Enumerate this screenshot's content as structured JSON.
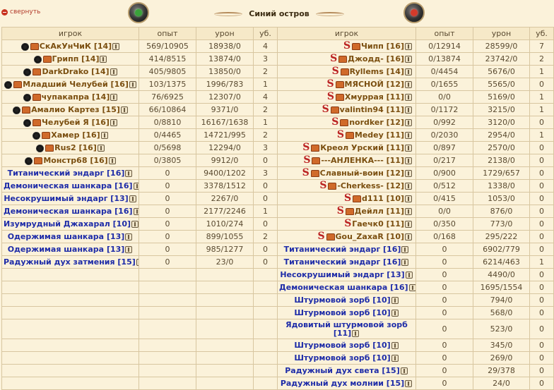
{
  "collapse_label": "свернуть",
  "battle_title": "Синий остров",
  "columns": {
    "player": "игрок",
    "exp": "опыт",
    "dmg": "урон",
    "kills": "уб."
  },
  "left": [
    {
      "name": "СкАкУнЧиК [14]",
      "type": "player",
      "ally": true,
      "crown": true,
      "exp": "569/10905",
      "dmg": "18938/0",
      "kills": "4"
    },
    {
      "name": "Грипп [14]",
      "type": "player",
      "ally": true,
      "crown": true,
      "exp": "414/8515",
      "dmg": "13874/0",
      "kills": "3"
    },
    {
      "name": "DarkDrako [14]",
      "type": "player",
      "ally": true,
      "crown": true,
      "exp": "405/9805",
      "dmg": "13850/0",
      "kills": "2"
    },
    {
      "name": "Младший Челубей [16]",
      "type": "player",
      "ally": true,
      "crown": true,
      "exp": "103/1375",
      "dmg": "1996/783",
      "kills": "1"
    },
    {
      "name": "чупакапра [14]",
      "type": "player",
      "ally": true,
      "crown": true,
      "exp": "76/6925",
      "dmg": "12307/0",
      "kills": "4"
    },
    {
      "name": "Амалио Картез [15]",
      "type": "player",
      "ally": true,
      "crown": true,
      "exp": "66/10864",
      "dmg": "9371/0",
      "kills": "2"
    },
    {
      "name": "Челубей Я [16]",
      "type": "player",
      "ally": true,
      "crown": true,
      "exp": "0/8810",
      "dmg": "16167/1638",
      "kills": "1"
    },
    {
      "name": "Хамер [16]",
      "type": "player",
      "ally": true,
      "crown": true,
      "exp": "0/4465",
      "dmg": "14721/995",
      "kills": "2"
    },
    {
      "name": "Rus2 [16]",
      "type": "player",
      "ally": true,
      "crown": true,
      "exp": "0/5698",
      "dmg": "12294/0",
      "kills": "3"
    },
    {
      "name": "Монстр68 [16]",
      "type": "player",
      "ally": true,
      "crown": true,
      "exp": "0/3805",
      "dmg": "9912/0",
      "kills": "0"
    },
    {
      "name": "Титанический эндарг [16]",
      "type": "bot",
      "exp": "0",
      "dmg": "9400/1202",
      "kills": "3"
    },
    {
      "name": "Демоническая шанкара [16]",
      "type": "bot",
      "exp": "0",
      "dmg": "3378/1512",
      "kills": "0"
    },
    {
      "name": "Несокрушимый эндарг [13]",
      "type": "bot",
      "exp": "0",
      "dmg": "2267/0",
      "kills": "0"
    },
    {
      "name": "Демоническая шанкара [16]",
      "type": "bot",
      "exp": "0",
      "dmg": "2177/2246",
      "kills": "1"
    },
    {
      "name": "Изумрудный Джахарал [10]",
      "type": "bot",
      "exp": "0",
      "dmg": "1010/274",
      "kills": "0"
    },
    {
      "name": "Одержимая шанкара [13]",
      "type": "bot",
      "exp": "0",
      "dmg": "899/1055",
      "kills": "2"
    },
    {
      "name": "Одержимая шанкара [13]",
      "type": "bot",
      "exp": "0",
      "dmg": "985/1277",
      "kills": "0"
    },
    {
      "name": "Радужный дух затмения [15]",
      "type": "bot",
      "exp": "0",
      "dmg": "23/0",
      "kills": "0"
    }
  ],
  "right": [
    {
      "name": "Чипп [16]",
      "type": "player",
      "clan": true,
      "crown": true,
      "exp": "0/12914",
      "dmg": "28599/0",
      "kills": "7"
    },
    {
      "name": "Джодд- [16]",
      "type": "player",
      "clan": true,
      "crown": true,
      "exp": "0/13874",
      "dmg": "23742/0",
      "kills": "2"
    },
    {
      "name": "Ryllems [14]",
      "type": "player",
      "clan": true,
      "crown": true,
      "exp": "0/4454",
      "dmg": "5676/0",
      "kills": "1"
    },
    {
      "name": "МЯСНОЙ [12]",
      "type": "player",
      "clan": true,
      "crown": true,
      "exp": "0/1655",
      "dmg": "5565/0",
      "kills": "0"
    },
    {
      "name": "Хмуррая [11]",
      "type": "player",
      "clan": true,
      "crown": true,
      "exp": "0/0",
      "dmg": "5169/0",
      "kills": "1"
    },
    {
      "name": "valintin94 [11]",
      "type": "player",
      "clan": true,
      "crown": true,
      "exp": "0/1172",
      "dmg": "3215/0",
      "kills": "1"
    },
    {
      "name": "nordker [12]",
      "type": "player",
      "clan": true,
      "crown": true,
      "exp": "0/992",
      "dmg": "3120/0",
      "kills": "0"
    },
    {
      "name": "Medey [11]",
      "type": "player",
      "clan": true,
      "crown": true,
      "exp": "0/2030",
      "dmg": "2954/0",
      "kills": "1"
    },
    {
      "name": "Креол Урский [11]",
      "type": "player",
      "clan": true,
      "crown": true,
      "exp": "0/897",
      "dmg": "2570/0",
      "kills": "0"
    },
    {
      "name": "---АНЛЕНКА--- [11]",
      "type": "player",
      "clan": true,
      "crown": true,
      "exp": "0/217",
      "dmg": "2138/0",
      "kills": "0"
    },
    {
      "name": "Славный-воин [12]",
      "type": "player",
      "clan": true,
      "crown": true,
      "exp": "0/900",
      "dmg": "1729/657",
      "kills": "0"
    },
    {
      "name": "-Cherkess- [12]",
      "type": "player",
      "clan": true,
      "crown": true,
      "exp": "0/512",
      "dmg": "1338/0",
      "kills": "0"
    },
    {
      "name": "d111 [10]",
      "type": "player",
      "clan": true,
      "crown": true,
      "exp": "0/415",
      "dmg": "1053/0",
      "kills": "0"
    },
    {
      "name": "Дейлл [11]",
      "type": "player",
      "clan": true,
      "crown": true,
      "exp": "0/0",
      "dmg": "876/0",
      "kills": "0"
    },
    {
      "name": "Гаечк0 [11]",
      "type": "player",
      "clan": true,
      "crown": false,
      "exp": "0/350",
      "dmg": "773/0",
      "kills": "0"
    },
    {
      "name": "Gou_ZaxaR [10]",
      "type": "player",
      "clan": true,
      "crown": true,
      "exp": "0/168",
      "dmg": "295/222",
      "kills": "0"
    },
    {
      "name": "Титанический эндарг [16]",
      "type": "bot",
      "exp": "0",
      "dmg": "6902/779",
      "kills": "0"
    },
    {
      "name": "Титанический эндарг [16]",
      "type": "bot",
      "exp": "0",
      "dmg": "6214/463",
      "kills": "1"
    },
    {
      "name": "Несокрушимый эндарг [13]",
      "type": "bot",
      "exp": "0",
      "dmg": "4490/0",
      "kills": "0"
    },
    {
      "name": "Демоническая шанкара [16]",
      "type": "bot",
      "exp": "0",
      "dmg": "1695/1554",
      "kills": "0"
    },
    {
      "name": "Штурмовой зорб [10]",
      "type": "bot",
      "exp": "0",
      "dmg": "794/0",
      "kills": "0"
    },
    {
      "name": "Штурмовой зорб [10]",
      "type": "bot",
      "exp": "0",
      "dmg": "568/0",
      "kills": "0"
    },
    {
      "name": "Ядовитый штурмовой зорб [11]",
      "type": "bot",
      "exp": "0",
      "dmg": "523/0",
      "kills": "0",
      "tall": true
    },
    {
      "name": "Штурмовой зорб [10]",
      "type": "bot",
      "exp": "0",
      "dmg": "345/0",
      "kills": "0"
    },
    {
      "name": "Штурмовой зорб [10]",
      "type": "bot",
      "exp": "0",
      "dmg": "269/0",
      "kills": "0"
    },
    {
      "name": "Радужный дух света [15]",
      "type": "bot",
      "exp": "0",
      "dmg": "29/378",
      "kills": "0"
    },
    {
      "name": "Радужный дух молнии [15]",
      "type": "bot",
      "exp": "0",
      "dmg": "24/0",
      "kills": "0"
    }
  ]
}
